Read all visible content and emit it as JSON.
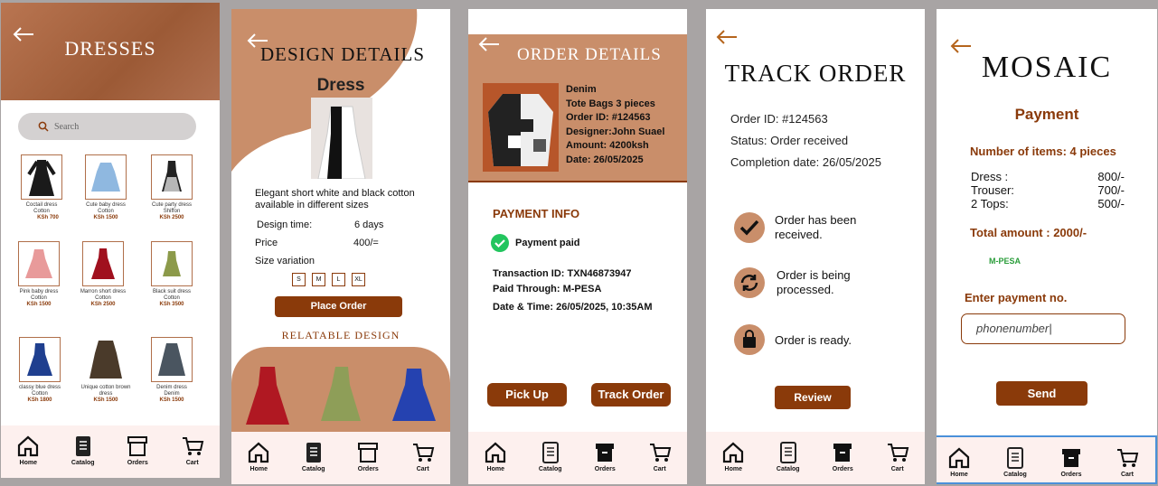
{
  "nav": {
    "home": "Home",
    "catalog": "Catalog",
    "orders": "Orders",
    "cart": "Cart"
  },
  "s1": {
    "title": "DRESSES",
    "search_placeholder": "Search",
    "items": [
      {
        "name": "Coctail dress",
        "fabric": "Cotton",
        "price": "KSh 700"
      },
      {
        "name": "Cute baby dress",
        "fabric": "Cotton",
        "price": "KSh 1500"
      },
      {
        "name": "Cute party dress",
        "fabric": "Shiffon",
        "price": "KSh 2500"
      },
      {
        "name": "Pink baby dress",
        "fabric": "Cotton",
        "price": "KSh 1500"
      },
      {
        "name": "Marron short dress",
        "fabric": "Cotton",
        "price": "KSh 2500"
      },
      {
        "name": "Black suit dress",
        "fabric": "Cotton",
        "price": "KSh 3500"
      },
      {
        "name": "classy blue dress",
        "fabric": "Cotton",
        "price": "KSh 1800"
      },
      {
        "name": "Unique cotton brown dress",
        "fabric": "",
        "price": "KSh 1500"
      },
      {
        "name": "Denim dress",
        "fabric": "Denim",
        "price": "KSh 1500"
      }
    ]
  },
  "s2": {
    "title": "DESIGN DETAILS",
    "subtitle": "Dress",
    "description": "Elegant short white and black cotton available in different sizes",
    "design_time_label": "Design time:",
    "design_time": "6 days",
    "price_label": "Price",
    "price": "400/=",
    "size_label": "Size variation",
    "sizes": [
      "S",
      "M",
      "L",
      "XL"
    ],
    "place_order": "Place Order",
    "relatable": "RELATABLE DESIGN"
  },
  "s3": {
    "title": "ORDER DETAILS",
    "lines": [
      "Denim",
      "Tote Bags 3 pieces",
      "Order ID: #124563",
      "Designer:John Suael",
      "Amount: 4200ksh",
      "Date: 26/05/2025"
    ],
    "payment_info": "PAYMENT INFO",
    "payment_status": "Payment paid",
    "transaction": "Transaction ID: TXN46873947",
    "paid_through": "Paid Through: M-PESA",
    "datetime": "Date & Time: 26/05/2025, 10:35AM",
    "pickup": "Pick Up",
    "track": "Track Order"
  },
  "s4": {
    "title": "TRACK ORDER",
    "order_id": "Order ID: #124563",
    "status": "Status: Order received",
    "completion": "Completion date: 26/05/2025",
    "step1": "Order has been received.",
    "step2": "Order is being processed.",
    "step3": "Order  is ready.",
    "review": "Review"
  },
  "s5": {
    "title": "MOSAIC",
    "payment": "Payment",
    "items_label": "Number of items:  4 pieces",
    "rows": [
      {
        "name": "Dress  :",
        "price": "800/-"
      },
      {
        "name": "Trouser:",
        "price": "700/-"
      },
      {
        "name": "2 Tops:",
        "price": "500/-"
      }
    ],
    "total": "Total amount : 2000/-",
    "mpesa": "M-PESA",
    "enter_label": "Enter payment no.",
    "phone_value": "phonenumber",
    "send": "Send"
  },
  "colors": {
    "brown": "#8a3a0a",
    "tan": "#c98e6a",
    "header": "#b4754f",
    "navbg": "#fdf0ee"
  }
}
